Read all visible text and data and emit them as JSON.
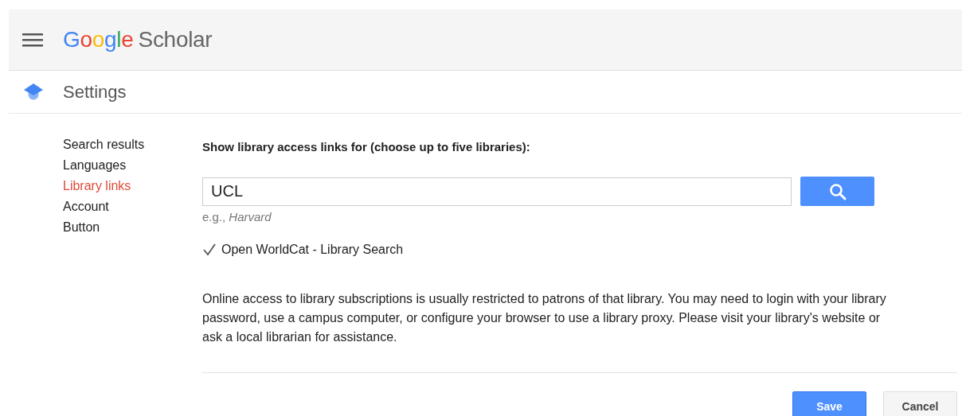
{
  "header": {
    "logo_brand": "Google",
    "logo_product": "Scholar"
  },
  "page_title": "Settings",
  "sidebar": {
    "items": [
      {
        "label": "Search results",
        "selected": false
      },
      {
        "label": "Languages",
        "selected": false
      },
      {
        "label": "Library links",
        "selected": true
      },
      {
        "label": "Account",
        "selected": false
      },
      {
        "label": "Button",
        "selected": false
      }
    ]
  },
  "main": {
    "heading": "Show library access links for (choose up to five libraries):",
    "search": {
      "value": "UCL",
      "hint_prefix": "e.g.,",
      "hint_example": "Harvard"
    },
    "options": [
      {
        "label": "Open WorldCat - Library Search",
        "checked": true
      }
    ],
    "note": "Online access to library subscriptions is usually restricted to patrons of that library. You may need to login with your library password, use a campus computer, or configure your browser to use a library proxy. Please visit your library's website or ask a local librarian for assistance.",
    "buttons": [
      {
        "label": "Save",
        "kind": "primary"
      },
      {
        "label": "Cancel",
        "kind": "secondary"
      }
    ]
  }
}
